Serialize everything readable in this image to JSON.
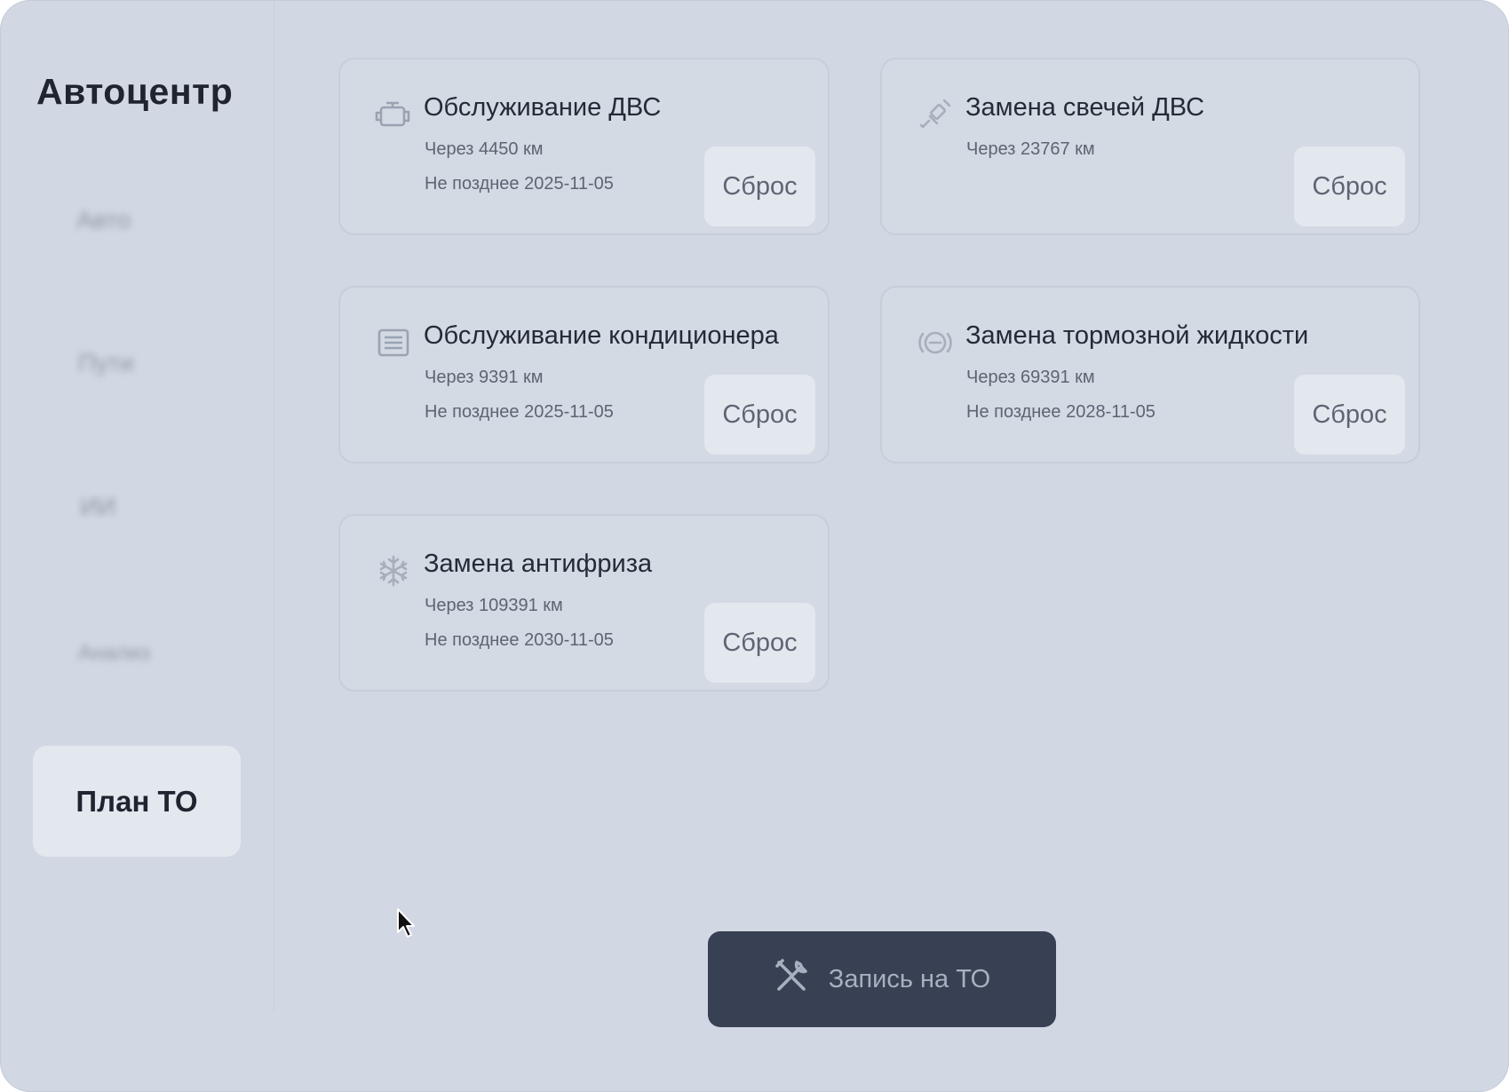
{
  "sidebar": {
    "brand": "Автоцентр",
    "blurred_items": [
      "Авто",
      "Пути",
      "ИИ",
      "Анализ"
    ],
    "active_item": "План ТО"
  },
  "cards": [
    {
      "icon": "engine-icon",
      "title": "Обслуживание ДВС",
      "line1": "Через 4450 км",
      "line2": "Не позднее 2025-11-05",
      "button": "Сброс"
    },
    {
      "icon": "spark-plug-icon",
      "title": "Замена свечей ДВС",
      "line1": "Через 23767 км",
      "line2": "",
      "button": "Сброс"
    },
    {
      "icon": "air-filter-icon",
      "title": "Обслуживание кондиционера",
      "line1": "Через 9391 км",
      "line2": "Не позднее 2025-11-05",
      "button": "Сброс"
    },
    {
      "icon": "brake-icon",
      "title": "Замена тормозной жидкости",
      "line1": "Через 69391 км",
      "line2": "Не позднее 2028-11-05",
      "button": "Сброс"
    },
    {
      "icon": "snowflake-icon",
      "title": "Замена антифриза",
      "line1": "Через 109391 км",
      "line2": "Не позднее 2030-11-05",
      "button": "Сброс"
    }
  ],
  "book_button": {
    "icon": "tools-icon",
    "label": "Запись на ТО"
  },
  "colors": {
    "background": "#d1d8e3",
    "button_dark": "#384153",
    "button_light": "#e3e8ef"
  }
}
